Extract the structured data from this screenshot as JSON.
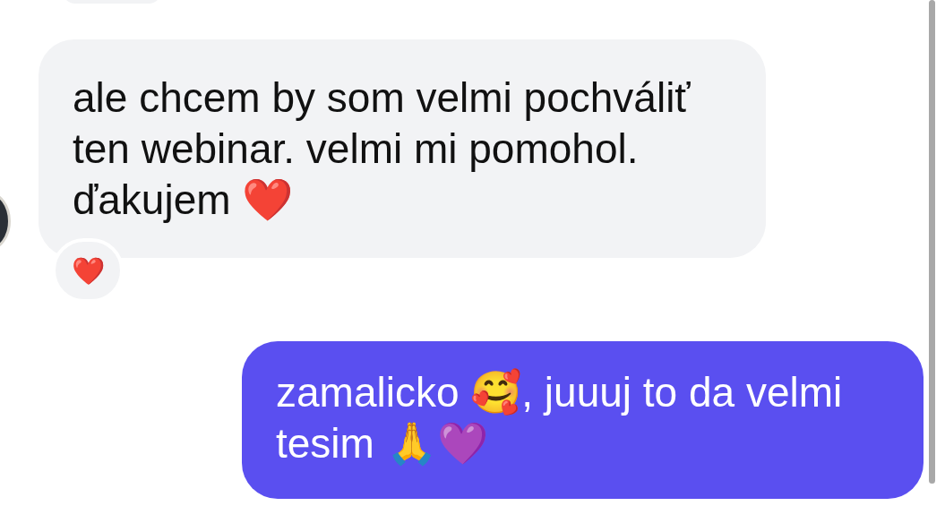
{
  "messages": [
    {
      "kind": "incoming",
      "lines": [
        "ale chcem by som velmi pochváliť",
        "ten webinar. velmi mi pomohol.",
        "ďakujem ❤️"
      ],
      "reactions": [
        "❤️"
      ]
    },
    {
      "kind": "outgoing",
      "lines": [
        "zamalicko 🥰, juuuj to da velmi",
        "tesim 🙏💜"
      ]
    }
  ]
}
